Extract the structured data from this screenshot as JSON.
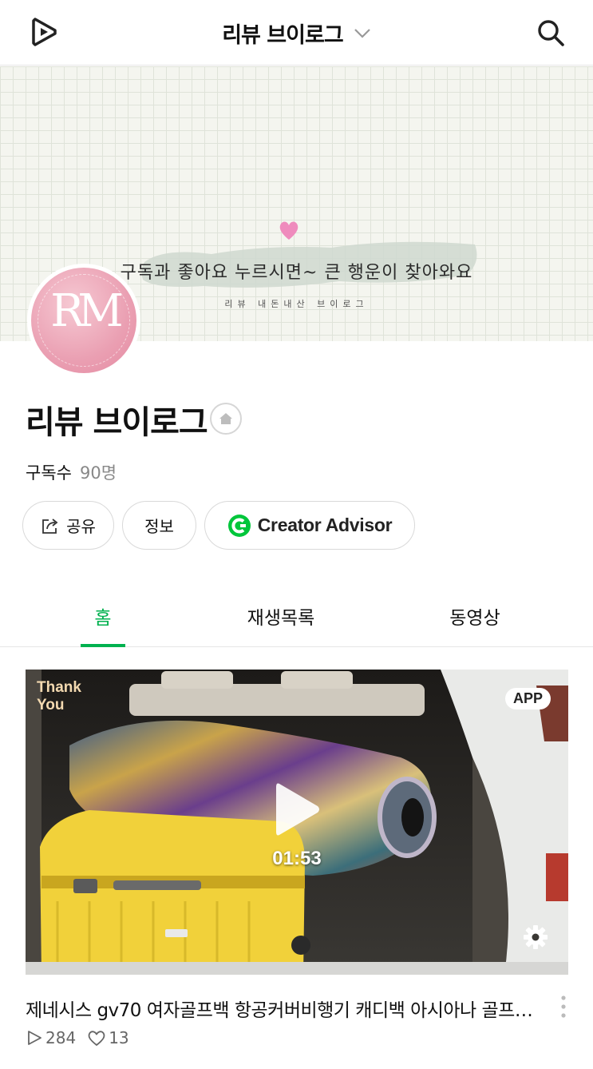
{
  "header": {
    "title": "리뷰 브이로그",
    "logo_icon": "naver-tv-play-logo-icon",
    "search_icon": "search-icon",
    "dropdown_icon": "chevron-down-icon"
  },
  "banner": {
    "main_text": "구독과 좋아요 누르시면~ 큰 행운이 찾아와요",
    "sub_text": "리뷰 내돈내산 브이로그",
    "heart_icon": "heart-icon"
  },
  "avatar": {
    "letters": "RM"
  },
  "channel": {
    "name": "리뷰 브이로그",
    "home_icon": "home-icon",
    "subscribers_label": "구독수",
    "subscribers_count": "90명"
  },
  "actions": {
    "share_label": "공유",
    "info_label": "정보",
    "creator_label": "Creator Advisor"
  },
  "tabs": [
    {
      "label": "홈",
      "active": true
    },
    {
      "label": "재생목록",
      "active": false
    },
    {
      "label": "동영상",
      "active": false
    }
  ],
  "video": {
    "badge": "APP",
    "overlay_line1": "Thank",
    "overlay_line2": "You",
    "duration": "01:53",
    "title": "제네시스 gv70 여자골프백 항공커버비행기 캐디백 아시아나 골프채…",
    "views": "284",
    "likes": "13"
  },
  "colors": {
    "accent": "#00b14f",
    "text": "#111111",
    "muted": "#888888"
  }
}
